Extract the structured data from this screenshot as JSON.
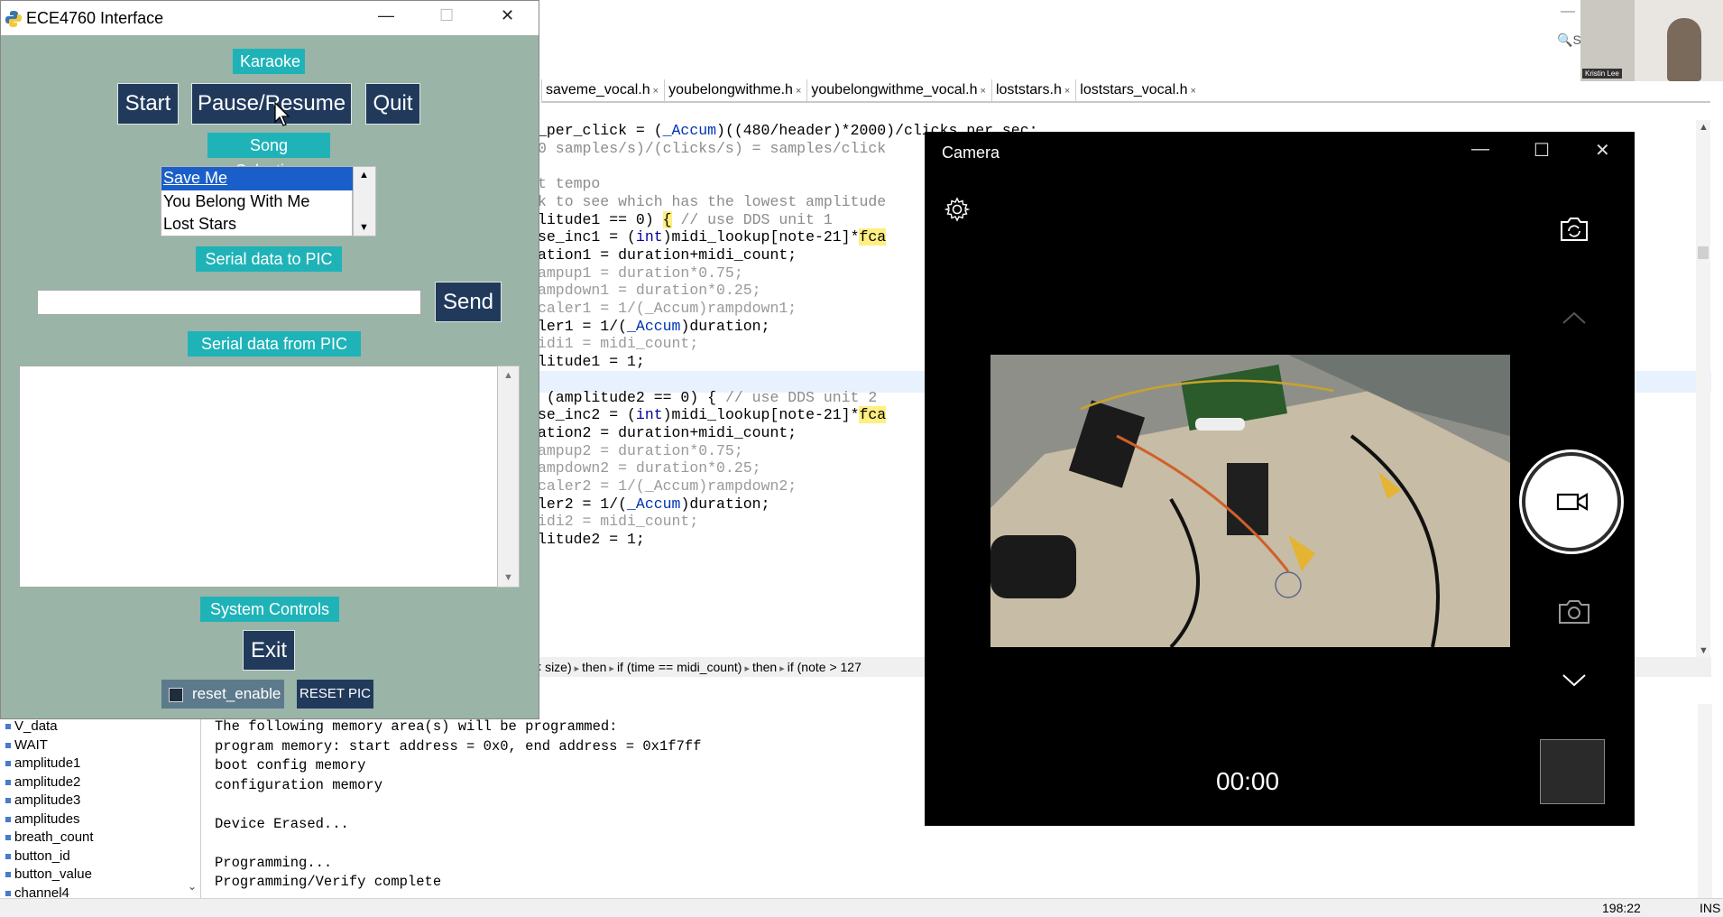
{
  "ide": {
    "tabs": [
      "saveme_vocal.h",
      "youbelongwithme.h",
      "youbelongwithme_vocal.h",
      "loststars.h",
      "loststars_vocal.h"
    ],
    "code_lines": [
      {
        "html": "_per_click = (<span class='typ'>_Accum</span>)((480/header)*2000)/clicks_per_sec;"
      },
      {
        "html": "<span class='cm'>0 samples/s)/(clicks/s) = samples/click</span>"
      },
      {
        "html": ""
      },
      {
        "html": "<span class='cm'>t tempo</span>"
      },
      {
        "html": "<span class='cm'>k to see which has the lowest amplitude</span>"
      },
      {
        "html": "litude1 == 0) <span class='mk'>{</span> <span class='cm'>// use DDS unit 1</span>"
      },
      {
        "html": "se_inc1 = (<span class='kw'>int</span>)midi_lookup[note-21]*<span class='mk'>fca</span>"
      },
      {
        "html": "ation1 = duration+midi_count;"
      },
      {
        "html": "<span class='gray'>ampup1 = duration*0.75;</span>"
      },
      {
        "html": "<span class='gray'>ampdown1 = duration*0.25;</span>"
      },
      {
        "html": "<span class='gray'>caler1 = 1/(_Accum)rampdown1;</span>"
      },
      {
        "html": "ler1 = 1/(<span class='typ'>_Accum</span>)duration;"
      },
      {
        "html": "<span class='gray'>idi1 = midi_count;</span>"
      },
      {
        "html": "litude1 = 1;"
      },
      {
        "html": ""
      },
      {
        "html": " (amplitude2 == 0) { <span class='cm'>// use DDS unit 2</span>"
      },
      {
        "html": "se_inc2 = (<span class='kw'>int</span>)midi_lookup[note-21]*<span class='mk'>fca</span>"
      },
      {
        "html": "ation2 = duration+midi_count;"
      },
      {
        "html": "<span class='gray'>ampup2 = duration*0.75;</span>"
      },
      {
        "html": "<span class='gray'>ampdown2 = duration*0.25;</span>"
      },
      {
        "html": "<span class='gray'>caler2 = 1/(_Accum)rampdown2;</span>"
      },
      {
        "html": "ler2 = 1/(<span class='typ'>_Accum</span>)duration;"
      },
      {
        "html": "<span class='gray'>idi2 = midi_count;</span>"
      },
      {
        "html": "litude2 = 1;"
      }
    ],
    "breadcrumb": [
      "< size)",
      "then",
      "if (time == midi_count)",
      "then",
      "if (note > 127"
    ],
    "nav_items": [
      "V_data",
      "WAIT",
      "amplitude1",
      "amplitude2",
      "amplitude3",
      "amplitudes",
      "breath_count",
      "button_id",
      "button_value",
      "channel4"
    ],
    "output_lines": [
      "The following memory area(s) will be programmed:",
      "program memory: start address = 0x0, end address = 0x1f7ff",
      "boot config memory",
      "configuration memory",
      "",
      "Device Erased...",
      "",
      "Programming...",
      "Programming/Verify complete"
    ],
    "status_position": "198:22",
    "status_mode": "INS",
    "search_text": "S",
    "webcam_name": "Kristin Lee"
  },
  "tk": {
    "title": "ECE4760 Interface",
    "karaoke_label": "Karaoke",
    "start_label": "Start",
    "pause_label": "Pause/Resume",
    "quit_label": "Quit",
    "song_selection_label": "Song Selection",
    "songs": [
      "Save Me",
      "You Belong With Me",
      "Lost Stars"
    ],
    "selected_song": "Save Me",
    "serial_to_label": "Serial data to PIC",
    "serial_input_value": "",
    "send_label": "Send",
    "serial_from_label": "Serial data from PIC",
    "serial_output_value": "",
    "system_controls_label": "System Controls",
    "exit_label": "Exit",
    "reset_enable_label": "reset_enable",
    "reset_enable_checked": false,
    "reset_pic_label": "RESET PIC"
  },
  "camera": {
    "title": "Camera",
    "timer": "00:00",
    "icons": [
      "settings-icon",
      "switch-camera-icon",
      "chevron-up-icon",
      "video-icon",
      "photo-camera-icon",
      "chevron-down-icon"
    ]
  }
}
